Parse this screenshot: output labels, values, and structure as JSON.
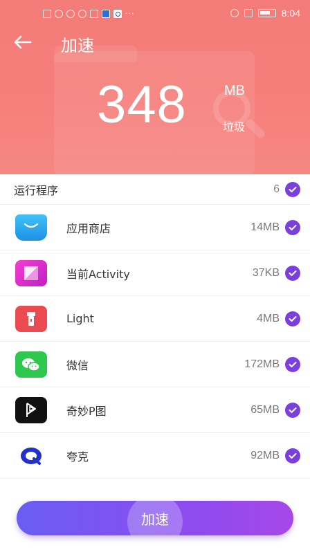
{
  "status_bar": {
    "time": "8:04"
  },
  "header": {
    "title": "加速"
  },
  "summary": {
    "number": "348",
    "unit": "MB",
    "label": "垃圾"
  },
  "list": {
    "title": "运行程序",
    "count": "6",
    "items": [
      {
        "name": "应用商店",
        "size": "14MB",
        "icon": "vivo-app-store-icon"
      },
      {
        "name": "当前Activity",
        "size": "37KB",
        "icon": "activity-icon"
      },
      {
        "name": "Light",
        "size": "4MB",
        "icon": "flashlight-icon"
      },
      {
        "name": "微信",
        "size": "172MB",
        "icon": "wechat-icon"
      },
      {
        "name": "奇妙P图",
        "size": "65MB",
        "icon": "photo-editor-icon"
      },
      {
        "name": "夸克",
        "size": "92MB",
        "icon": "quark-browser-icon"
      }
    ]
  },
  "action": {
    "label": "加速"
  },
  "colors": {
    "header_bg": "#f47c78",
    "accent_purple": "#7b3fe0",
    "button_gradient_start": "#6a5df2",
    "button_gradient_end": "#a648e8"
  }
}
